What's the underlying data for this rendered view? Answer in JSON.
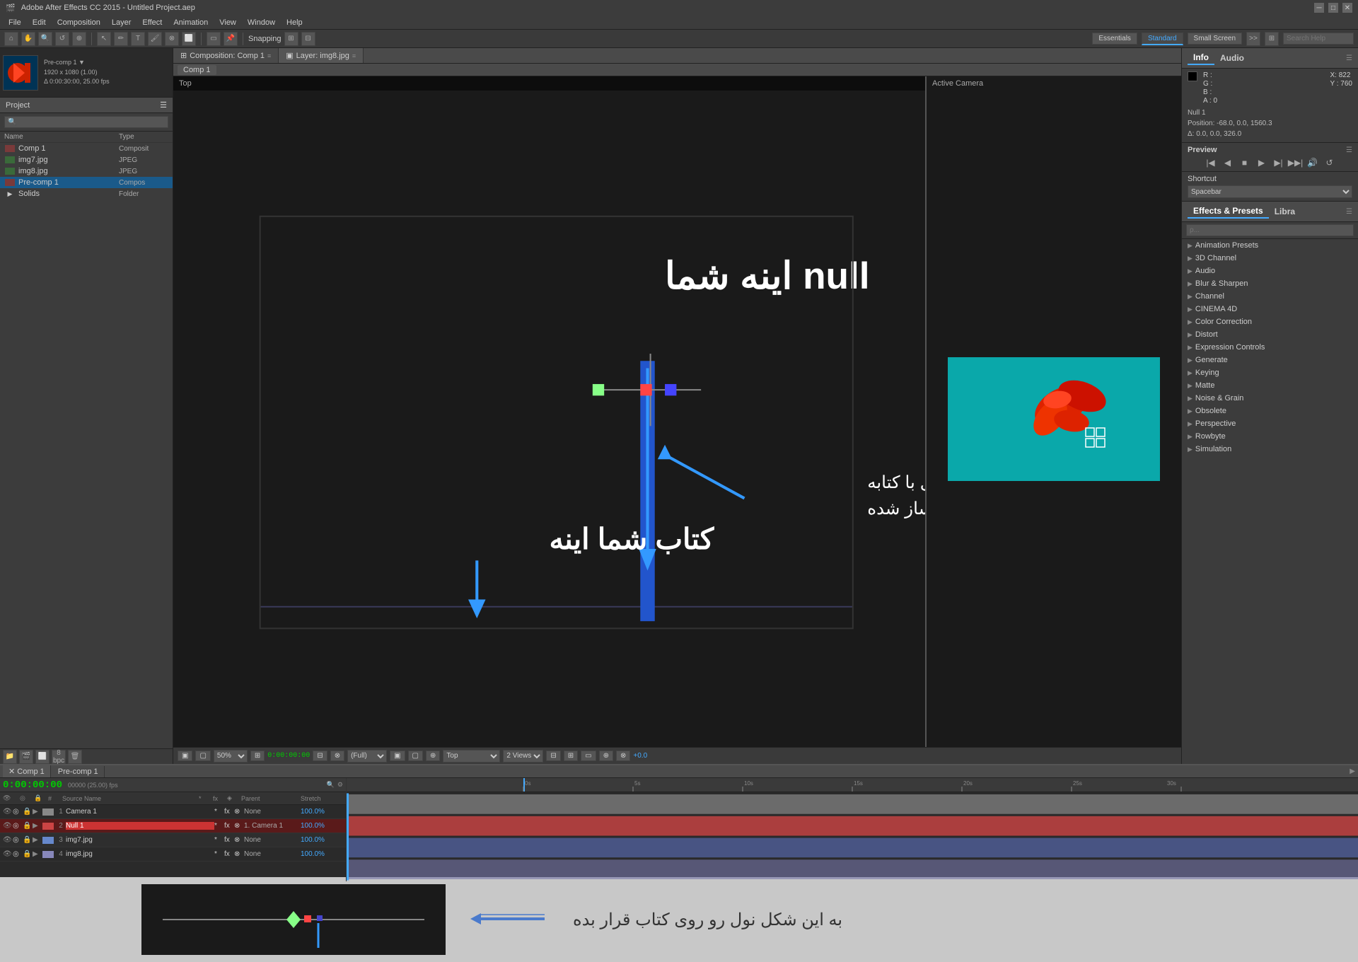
{
  "app": {
    "title": "Adobe After Effects CC 2015 - Untitled Project.aep",
    "menus": [
      "File",
      "Edit",
      "Composition",
      "Layer",
      "Effect",
      "Animation",
      "View",
      "Window",
      "Help"
    ]
  },
  "toolbar": {
    "snap_label": "Snapping",
    "workspaces": [
      "Essentials",
      "Standard",
      "Small Screen"
    ],
    "search_placeholder": "Search Help"
  },
  "project": {
    "title": "Project",
    "search_placeholder": "",
    "col_name": "Name",
    "col_type": "Type",
    "thumbnail_info": "Pre-comp 1\n1920 x 1080 (1.00)\nΔ 0:00:30:00, 25.00 fps",
    "items": [
      {
        "name": "Comp 1",
        "type": "Composit",
        "icon": "comp"
      },
      {
        "name": "img7.jpg",
        "type": "JPEG",
        "icon": "jpeg"
      },
      {
        "name": "img8.jpg",
        "type": "JPEG",
        "icon": "jpeg"
      },
      {
        "name": "Pre-comp 1",
        "type": "Compos",
        "icon": "comp",
        "selected": true
      },
      {
        "name": "Solids",
        "type": "Folder",
        "icon": "folder"
      }
    ]
  },
  "viewer": {
    "tabs": [
      {
        "label": "Composition: Comp 1",
        "active": true
      },
      {
        "label": "Layer: img8.jpg"
      }
    ],
    "comp_tab": "Comp 1",
    "left_view": {
      "label": "Top",
      "header_right": ""
    },
    "right_view": {
      "label": "Active Camera"
    },
    "controls": {
      "zoom": "50%",
      "time": "0:00:00:00",
      "quality": "Full",
      "view_label": "Top",
      "layout": "2 Views",
      "timecode_plus": "+0.0"
    }
  },
  "viewer_content": {
    "text1": "شما اینه  null",
    "text2": "کتاب شما اینه",
    "text3": "اینم فاصله نول با کتابه",
    "text4": "که مشکل ساز شده"
  },
  "right_panel": {
    "info_tab": "Info",
    "audio_tab": "Audio",
    "color": {
      "r": "R :",
      "g": "G :",
      "b": "B :",
      "a": "A : 0"
    },
    "coords": {
      "x": "X: 822",
      "y": "Y : 760"
    },
    "null_info": "Null 1\nPosition: -68.0, 0.0, 1560.3\nΔ: 0.0, 0.0, 326.0",
    "preview_title": "Preview",
    "shortcut_title": "Shortcut",
    "shortcut_value": "Spacebar",
    "effects_tab": "Effects & Presets",
    "library_tab": "Libra",
    "effects_search_placeholder": "ρ...",
    "categories": [
      "Animation Presets",
      "3D Channel",
      "Audio",
      "Blur & Sharpen",
      "Channel",
      "CINEMA 4D",
      "Color Correction",
      "Distort",
      "Expression Controls",
      "Generate",
      "Keying",
      "Matte",
      "Noise & Grain",
      "Obsolete",
      "Perspective",
      "Rowbyte",
      "Simulation"
    ]
  },
  "timeline": {
    "tabs": [
      {
        "label": "✕  Comp 1",
        "active": true
      },
      {
        "label": "Pre-comp 1"
      }
    ],
    "time": "0:00:00:00",
    "fps": "00000 (25.00) fps",
    "layers": [
      {
        "num": 1,
        "name": "Camera 1",
        "parent": "None",
        "stretch": "100.0%",
        "color": "#aaaaaa"
      },
      {
        "num": 2,
        "name": "Null 1",
        "parent": "1. Camera 1",
        "stretch": "100.0%",
        "color": "#ff6666",
        "selected": true
      },
      {
        "num": 3,
        "name": "img7.jpg",
        "parent": "None",
        "stretch": "100.0%",
        "color": "#88aaff"
      },
      {
        "num": 4,
        "name": "img8.jpg",
        "parent": "None",
        "stretch": "100.0%",
        "color": "#aaaadd"
      }
    ],
    "ruler_marks": [
      "0s",
      "5s",
      "10s",
      "15s",
      "20s",
      "25s",
      "30s"
    ],
    "bar_colors": [
      "#888888",
      "#cc4444",
      "#6688cc",
      "#8888bb"
    ]
  },
  "explanation": {
    "text": "به این شکل نول رو روی کتاب قرار بده"
  }
}
